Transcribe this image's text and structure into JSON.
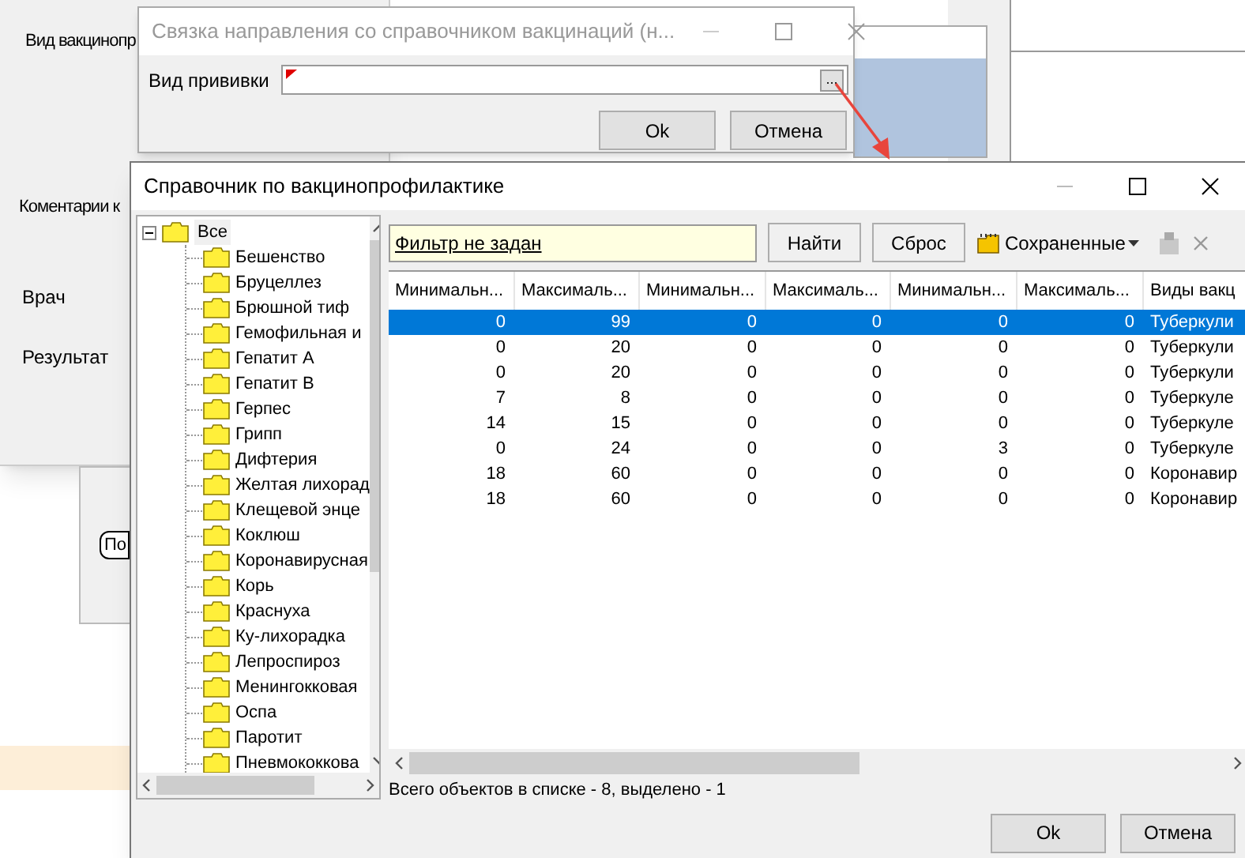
{
  "background_form": {
    "labels": [
      "Вид вакцинопр",
      "Коментарии к",
      "Врач",
      "Результат"
    ],
    "button": "По"
  },
  "link_dialog": {
    "title": "Связка направления со справочником вакцинаций (н...",
    "active": false,
    "field_label": "Вид прививки",
    "browse_button": "...",
    "buttons": [
      "Ok",
      "Отмена"
    ]
  },
  "directory_dialog": {
    "title": "Справочник по вакцинопрофилактике",
    "active": true,
    "tree": {
      "label": "Все",
      "expanded": true,
      "children": [
        {
          "label": "Бешенство"
        },
        {
          "label": "Бруцеллез"
        },
        {
          "label": "Брюшной тиф"
        },
        {
          "label": "Гемофильная и"
        },
        {
          "label": "Гепатит А"
        },
        {
          "label": "Гепатит В"
        },
        {
          "label": "Герпес"
        },
        {
          "label": "Грипп"
        },
        {
          "label": "Дифтерия"
        },
        {
          "label": "Желтая лихорад"
        },
        {
          "label": "Клещевой энце"
        },
        {
          "label": "Коклюш"
        },
        {
          "label": "Коронавирусная"
        },
        {
          "label": "Корь"
        },
        {
          "label": "Краснуха"
        },
        {
          "label": "Ку-лихорадка"
        },
        {
          "label": "Лепроспироз"
        },
        {
          "label": "Менингокковая"
        },
        {
          "label": "Оспа"
        },
        {
          "label": "Паротит"
        },
        {
          "label": "Пневмококкова"
        }
      ]
    },
    "filter": "Фильтр не задан",
    "toolbar_buttons": [
      "Найти",
      "Сброс"
    ],
    "saved": "Сохраненные",
    "table": {
      "columns": [
        "Минимальн...",
        "Максималь...",
        "Минимальн...",
        "Максималь...",
        "Минимальн...",
        "Максималь...",
        "Виды вакц"
      ],
      "rows": [
        {
          "selected": true,
          "cells": [
            "0",
            "99",
            "0",
            "0",
            "0",
            "0",
            "Туберкули"
          ]
        },
        {
          "selected": false,
          "cells": [
            "0",
            "20",
            "0",
            "0",
            "0",
            "0",
            "Туберкули"
          ]
        },
        {
          "selected": false,
          "cells": [
            "0",
            "20",
            "0",
            "0",
            "0",
            "0",
            "Туберкули"
          ]
        },
        {
          "selected": false,
          "cells": [
            "7",
            "8",
            "0",
            "0",
            "0",
            "0",
            "Туберкуле"
          ]
        },
        {
          "selected": false,
          "cells": [
            "14",
            "15",
            "0",
            "0",
            "0",
            "0",
            "Туберкуле"
          ]
        },
        {
          "selected": false,
          "cells": [
            "0",
            "24",
            "0",
            "0",
            "3",
            "0",
            "Туберкуле"
          ]
        },
        {
          "selected": false,
          "cells": [
            "18",
            "60",
            "0",
            "0",
            "0",
            "0",
            "Коронавир"
          ]
        },
        {
          "selected": false,
          "cells": [
            "18",
            "60",
            "0",
            "0",
            "0",
            "0",
            "Коронавир"
          ]
        }
      ]
    },
    "status": "Всего объектов в списке - 8, выделено - 1",
    "buttons": [
      "Ok",
      "Отмена"
    ]
  }
}
